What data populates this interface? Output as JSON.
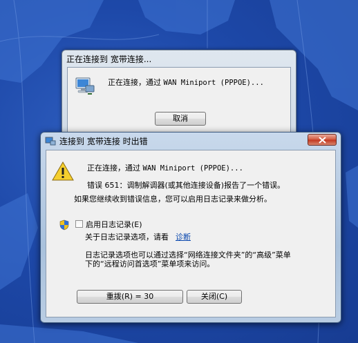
{
  "colors": {
    "desktop": "#1d48a8",
    "window_frame": "#a9c1dc",
    "close_button": "#c2341d",
    "link": "#0645ad"
  },
  "back_window": {
    "title": "正在连接到 宽带连接...",
    "icon": "network-computer-icon",
    "message_prefix": "正在连接，通过 ",
    "message_device": "WAN Miniport (PPPOE)...",
    "cancel_label": "取消"
  },
  "error_dialog": {
    "title": "连接到 宽带连接 时出错",
    "title_icon": "network-icon",
    "warning_icon": "warning-icon",
    "shield_icon": "uac-shield-icon",
    "connecting_prefix": "正在连接，通过 ",
    "connecting_device": "WAN Miniport (PPPOE)...",
    "error_line": "错误 651：调制解调器(或其他连接设备)报告了一个错误。",
    "advice_line": "如果您继续收到错误信息，您可以启用日志记录来做分析。",
    "logging_checkbox_label": "启用日志记录(E)",
    "logging_checked": false,
    "logging_info_prefix": "关于日志记录选项，请看",
    "diagnose_link": "诊断",
    "note_line1": "日志记录选项也可以通过选择“网络连接文件夹”的“高级”菜单",
    "note_line2": "下的“远程访问首选项”菜单项来访问。",
    "redial_label": "重拨(R) = 30",
    "close_label": "关闭(C)"
  }
}
